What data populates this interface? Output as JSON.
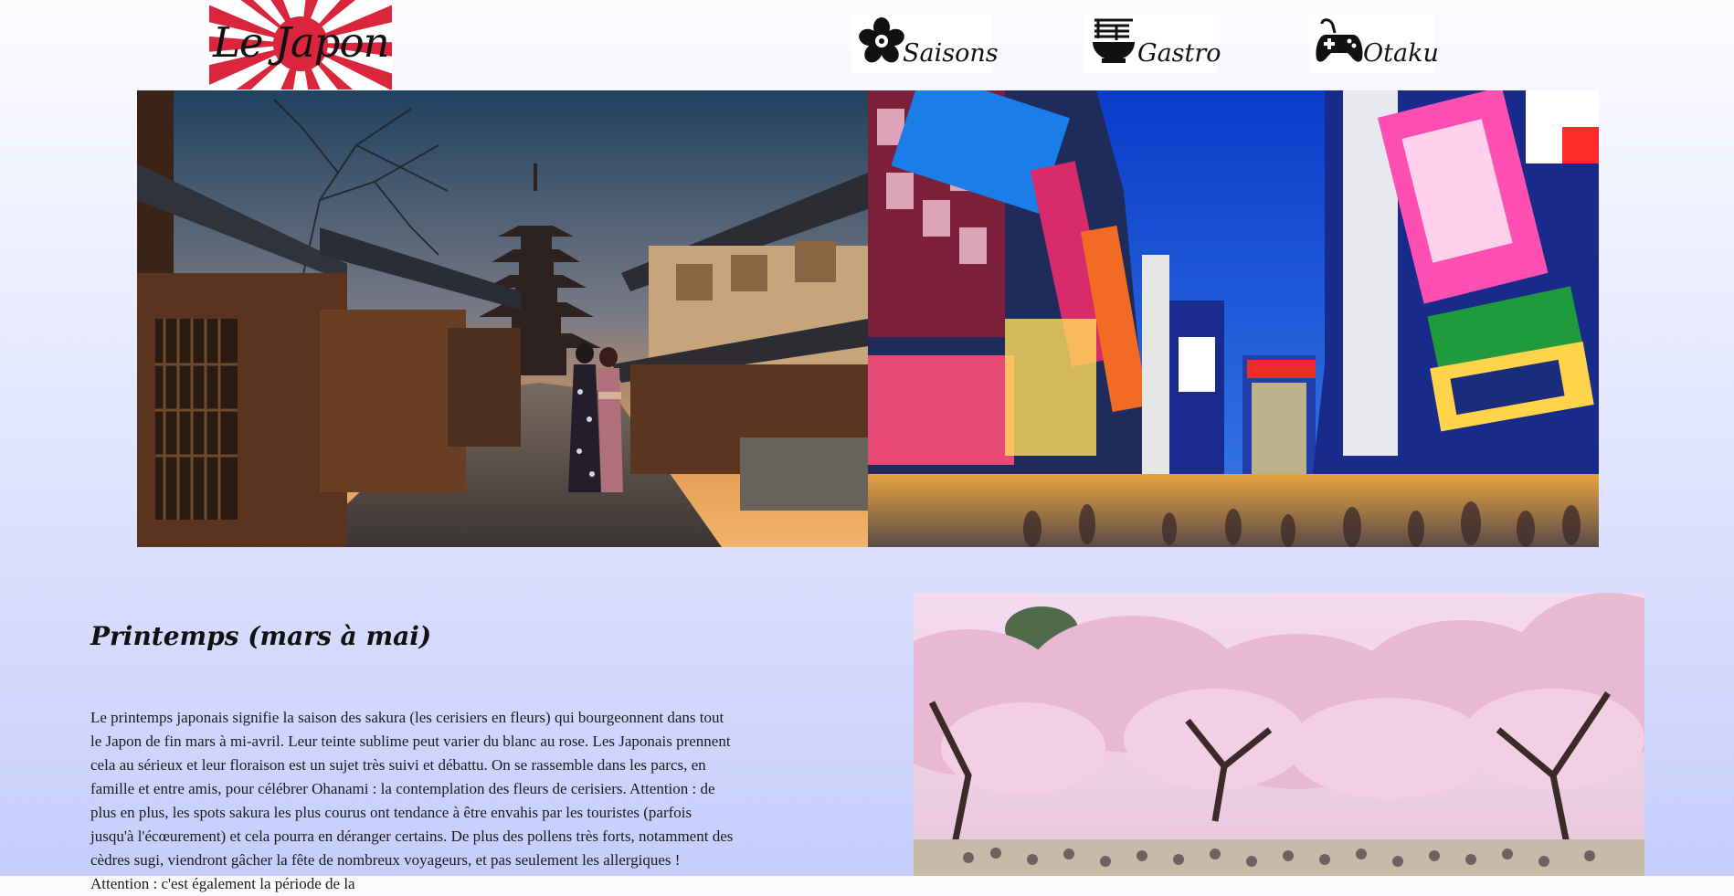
{
  "header": {
    "logo_text": "Le Japon",
    "nav": [
      {
        "label": "Saisons",
        "icon": "sakura-flower-icon"
      },
      {
        "label": "Gastro",
        "icon": "ramen-bowl-icon"
      },
      {
        "label": "Otaku",
        "icon": "gamepad-icon"
      }
    ]
  },
  "section": {
    "title": "Printemps (mars à mai)",
    "paragraph": "Le printemps japonais signifie la saison des sakura (les cerisiers en fleurs) qui bourgeonnent dans tout le Japon de fin mars à mi-avril. Leur teinte sublime peut varier du blanc au rose. Les Japonais prennent cela au sérieux et leur floraison est un sujet très suivi et débattu. On se rassemble dans les parcs, en famille et entre amis, pour célébrer Ohanami : la contemplation des fleurs de cerisiers. Attention : de plus en plus, les spots sakura les plus courus ont tendance à être envahis par les touristes (parfois jusqu'à l'écœurement) et cela pourra en déranger certains. De plus des pollens très forts, notamment des cèdres sugi, viendront gâcher la fête de nombreux voyageurs, et pas seulement les allergiques ! Attention : c'est également la période de la"
  },
  "images": {
    "banner_left": "kyoto-street-photo",
    "banner_right": "akihabara-street-photo",
    "section_image": "cherry-blossom-park-photo"
  },
  "colors": {
    "rising_sun_red": "#d9263c",
    "background_top": "#fcfcff",
    "background_bottom": "#c6cdfb"
  }
}
